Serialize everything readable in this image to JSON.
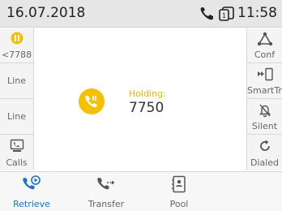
{
  "status": {
    "date": "16.07.2018",
    "time": "11:58"
  },
  "left_keys": [
    {
      "label": "<7788",
      "icon": "hold-status-icon"
    },
    {
      "label": "Line"
    },
    {
      "label": "Line"
    },
    {
      "label": "Calls",
      "icon": "calls-icon"
    }
  ],
  "right_keys": [
    {
      "label": "Conf",
      "icon": "conference-icon"
    },
    {
      "label": "SmartTr",
      "icon": "smart-transfer-icon"
    },
    {
      "label": "Silent",
      "icon": "mute-bell-icon"
    },
    {
      "label": "Dialed",
      "icon": "redial-icon"
    }
  ],
  "call": {
    "state_label": "Holding:",
    "number": "7750"
  },
  "softkeys": [
    {
      "label": "Retrieve",
      "icon": "retrieve-icon"
    },
    {
      "label": "Transfer",
      "icon": "transfer-icon"
    },
    {
      "label": "Pool",
      "icon": "pool-icon"
    }
  ],
  "colors": {
    "accent": "#1a73c8",
    "hold": "#f5c000"
  }
}
